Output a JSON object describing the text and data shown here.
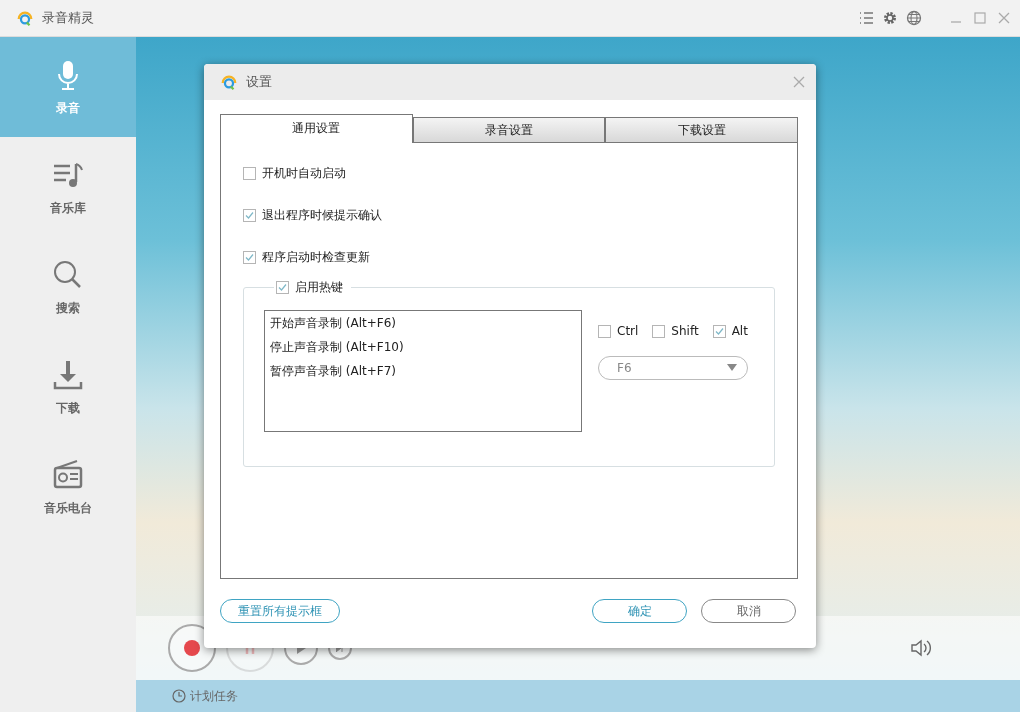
{
  "app": {
    "title": "录音精灵"
  },
  "sidebar": {
    "items": [
      {
        "label": "录音",
        "kind": "mic",
        "selected": true
      },
      {
        "label": "音乐库",
        "kind": "library",
        "selected": false
      },
      {
        "label": "搜索",
        "kind": "search",
        "selected": false
      },
      {
        "label": "下载",
        "kind": "download",
        "selected": false
      },
      {
        "label": "音乐电台",
        "kind": "radio",
        "selected": false
      }
    ]
  },
  "player": {
    "pause_disabled": true,
    "schedule_label": "计划任务"
  },
  "dialog": {
    "title": "设置",
    "tabs": [
      {
        "label": "通用设置",
        "selected": true
      },
      {
        "label": "录音设置",
        "selected": false
      },
      {
        "label": "下载设置",
        "selected": false
      }
    ],
    "options": [
      {
        "label": "开机时自动启动",
        "checked": false
      },
      {
        "label": "退出程序时候提示确认",
        "checked": true
      },
      {
        "label": "程序启动时检查更新",
        "checked": true
      }
    ],
    "hotkeys": {
      "label": "启用热键",
      "checked": true,
      "actions": [
        {
          "label": "开始声音录制 (Alt+F6)"
        },
        {
          "label": "停止声音录制 (Alt+F10)"
        },
        {
          "label": "暂停声音录制 (Alt+F7)"
        }
      ],
      "modifiers": [
        {
          "label": "Ctrl",
          "checked": false
        },
        {
          "label": "Shift",
          "checked": false
        },
        {
          "label": "Alt",
          "checked": true
        }
      ],
      "key": "F6"
    },
    "buttons": {
      "reset": "重置所有提示框",
      "ok": "确定",
      "cancel": "取消"
    }
  }
}
